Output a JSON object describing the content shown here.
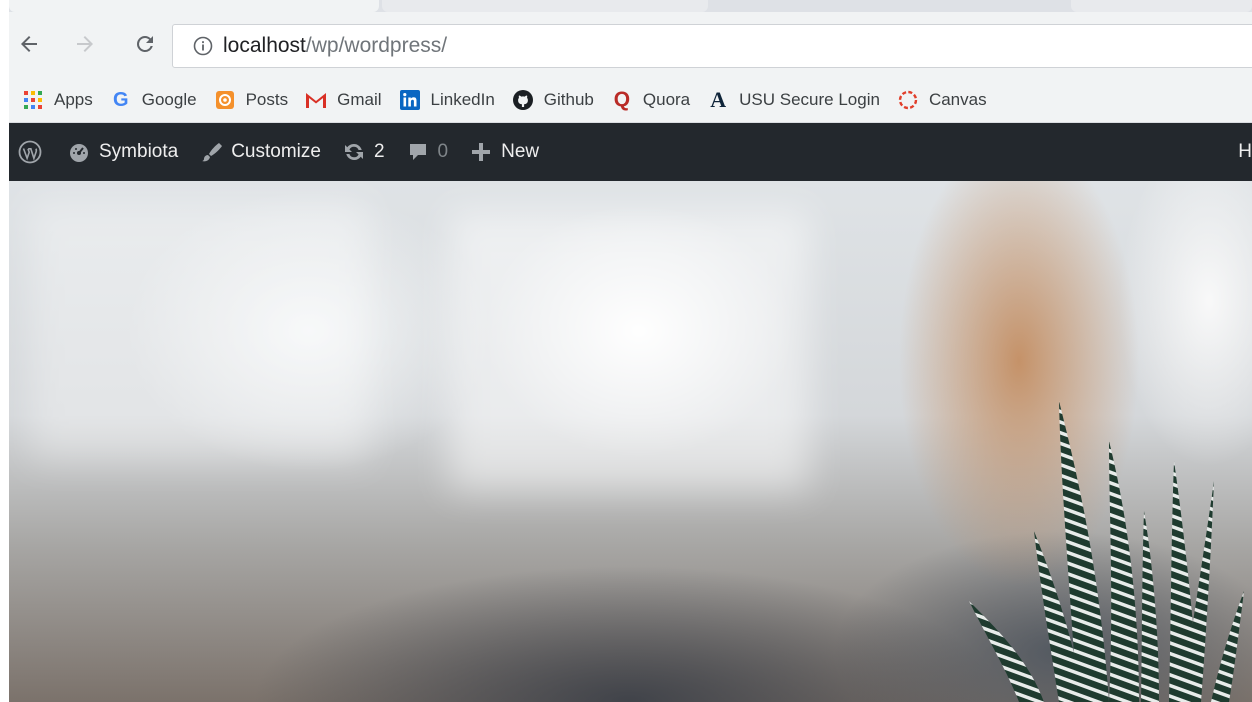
{
  "browser": {
    "url_host": "localhost",
    "url_path": "/wp/wordpress/",
    "info_icon": "info-icon"
  },
  "bookmarks": [
    {
      "label": "Apps",
      "icon": "apps-grid-icon"
    },
    {
      "label": "Google",
      "icon": "google-icon"
    },
    {
      "label": "Posts",
      "icon": "posts-icon"
    },
    {
      "label": "Gmail",
      "icon": "gmail-icon"
    },
    {
      "label": "LinkedIn",
      "icon": "linkedin-icon"
    },
    {
      "label": "Github",
      "icon": "github-icon"
    },
    {
      "label": "Quora",
      "icon": "quora-icon"
    },
    {
      "label": "USU Secure Login",
      "icon": "usu-icon"
    },
    {
      "label": "Canvas",
      "icon": "canvas-icon"
    }
  ],
  "adminbar": {
    "site_name": "Symbiota",
    "customize": "Customize",
    "updates_count": "2",
    "comments_count": "0",
    "new_label": "New",
    "right_partial": "H"
  },
  "colors": {
    "adminbar_bg": "#23282d",
    "browser_bg": "#f1f3f4",
    "google_blue": "#4285f4",
    "linkedin_blue": "#0a66c2",
    "quora_red": "#b92b27",
    "gmail_red": "#d93025",
    "posts_orange": "#f4902b"
  }
}
